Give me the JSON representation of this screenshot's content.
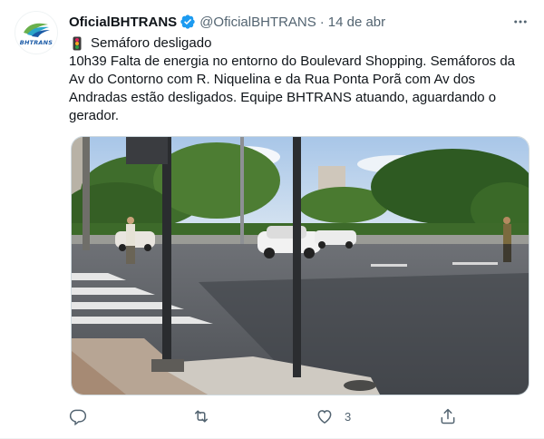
{
  "tweet": {
    "display_name": "OficialBHTRANS",
    "handle": "@OficialBHTRANS",
    "separator": "·",
    "date": "14 de abr",
    "avatar_text": "BHTRANS",
    "title_line": "Semáforo desligado",
    "body": "10h39 Falta de energia no entorno do Boulevard Shopping. Semáforos da Av do Contorno com R. Niquelina e da Rua Ponta Porã com Av dos Andradas estão desligados. Equipe BHTRANS  atuando, aguardando o gerador.",
    "body_lines": [
      "10h39 Falta de energia no entorno do Boulevard Shopping. Semáforos da",
      "Av do Contorno com R. Niquelina e da Rua Ponta Porã com Av dos",
      "Andradas estão desligados. Equipe BHTRANS  atuando, aguardando o",
      "gerador."
    ],
    "media_description_icon": "photo"
  },
  "icons": {
    "verified": "verified-badge-icon",
    "more": "more-options-icon",
    "reply": "reply-icon",
    "retweet": "retweet-icon",
    "like": "like-icon",
    "share": "share-icon",
    "traffic_light": "traffic-light-icon"
  },
  "actions": {
    "reply_count": "",
    "retweet_count": "",
    "like_count": "3",
    "share_count": ""
  },
  "colors": {
    "verified": "#1d9bf0",
    "text_primary": "#0f1419",
    "text_secondary": "#536471",
    "border": "#cfd9de",
    "brand_green": "#6ab04c",
    "brand_blue": "#1a5aa6"
  }
}
